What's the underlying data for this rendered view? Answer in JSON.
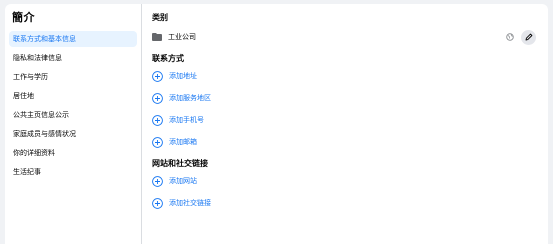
{
  "sidebar": {
    "title": "簡介",
    "items": [
      {
        "label": "联系方式和基本信息",
        "active": true
      },
      {
        "label": "隐私和法律信息"
      },
      {
        "label": "工作与学历"
      },
      {
        "label": "居住地"
      },
      {
        "label": "公共主页信息公示"
      },
      {
        "label": "家庭成员与感情状况"
      },
      {
        "label": "你的详细资料"
      },
      {
        "label": "生活纪事"
      }
    ]
  },
  "main": {
    "category": {
      "title": "类别",
      "value": "工业公司"
    },
    "contact": {
      "title": "联系方式",
      "add_address": "添加地址",
      "add_service_area": "添加服务地区",
      "add_phone": "添加手机号",
      "add_email": "添加邮箱"
    },
    "links": {
      "title": "网站和社交链接",
      "add_website": "添加网站",
      "add_social": "添加社交链接"
    }
  },
  "colors": {
    "accent": "#1877f2",
    "active_bg": "#e7f3ff"
  },
  "icons": {
    "folder": "folder-icon",
    "globe": "globe-icon",
    "edit": "pencil-icon",
    "add": "plus-circle-icon"
  }
}
